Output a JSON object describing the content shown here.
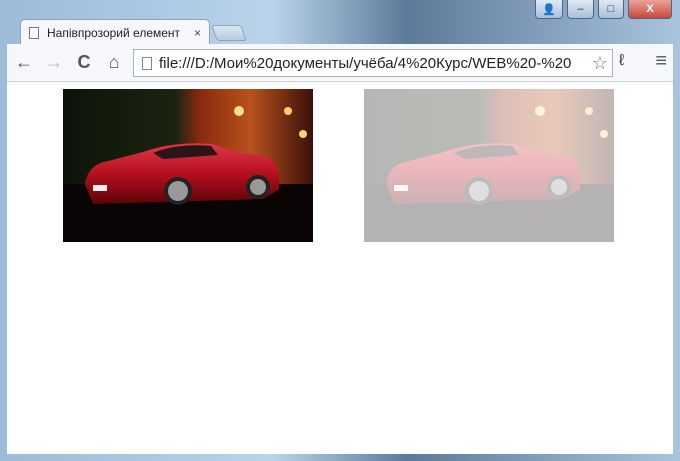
{
  "window": {
    "buttons": {
      "user": "user-icon",
      "minimize": "–",
      "maximize": "□",
      "close": "X"
    }
  },
  "tab": {
    "title": "Напівпрозорий елемент",
    "close": "×"
  },
  "toolbar": {
    "back": "←",
    "forward": "→",
    "reload": "C",
    "home": "⌂",
    "url": "file:///D:/Мои%20документы/учёба/4%20Курс/WEB%20-%20",
    "star": "☆",
    "extension": "ℓ",
    "menu": "≡"
  },
  "images": [
    {
      "name": "car-image-opaque",
      "opacity": 1
    },
    {
      "name": "car-image-translucent",
      "opacity": 0.3
    }
  ]
}
